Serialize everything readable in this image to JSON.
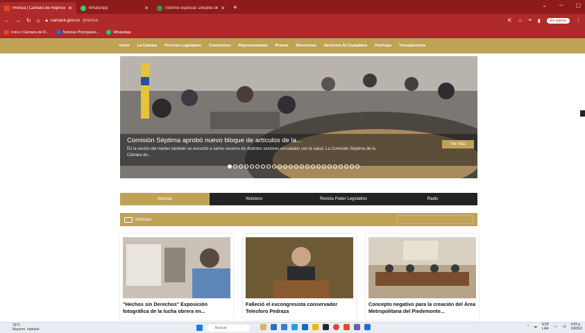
{
  "browser": {
    "tabs": [
      {
        "title": "Prensa | Camara de Representan",
        "color": "#e04a2a",
        "active": true
      },
      {
        "title": "WhatsApp",
        "color": "#25d366",
        "active": false
      },
      {
        "title": "Informe especial: Detalles de la l",
        "color": "#2d9e4f",
        "active": false
      }
    ],
    "new_tab": "+",
    "url_host": "camara.gov.co",
    "url_path": "/prensa",
    "paused_label": "En pausa",
    "bookmarks": [
      "Inicio | Camara de R...",
      "Noticias Principales...",
      "WhatsApp"
    ]
  },
  "nav": [
    "Inicio",
    "La Cámara",
    "Proceso Legislativo",
    "Comisiones",
    "Representantes",
    "Prensa",
    "Directorios",
    "Servicios Al Ciudadano",
    "Participa",
    "Transparencia"
  ],
  "hero": {
    "title": "Comisión Séptima aprobó nuevo bloque de artículos de la...",
    "summary": "En la sesión del martes también se escuchó a varios voceros de distintos sectores vinculados con la salud.   La Comisión Séptima de la Cámara de...",
    "button": "Ver más",
    "slide_count": 24,
    "active_slide": 1
  },
  "section_tabs": [
    "Noticias",
    "Noticiero",
    "Revista Poder Legislativo",
    "Radio"
  ],
  "active_section_tab": 0,
  "section_title": "Noticias",
  "cards": [
    {
      "title": "\"Hechos sin Derechos\" Exposición fotográfica de la lucha obrera en..."
    },
    {
      "title": "Falleció el excongresista conservador Telesforo Pedraza"
    },
    {
      "title": "Concepto negativo para la creación del Área Metropolitana del Piedemonte..."
    }
  ],
  "taskbar": {
    "weather_temp": "29°C",
    "weather_desc": "Mayorm. nublado",
    "search_placeholder": "Buscar",
    "lang": "ESP",
    "lang2": "LAA",
    "time": "4:59 p.",
    "date": "18/05/2"
  },
  "colors": {
    "brand_red": "#b02a2a",
    "gold": "#c0a257",
    "dark": "#232323"
  }
}
